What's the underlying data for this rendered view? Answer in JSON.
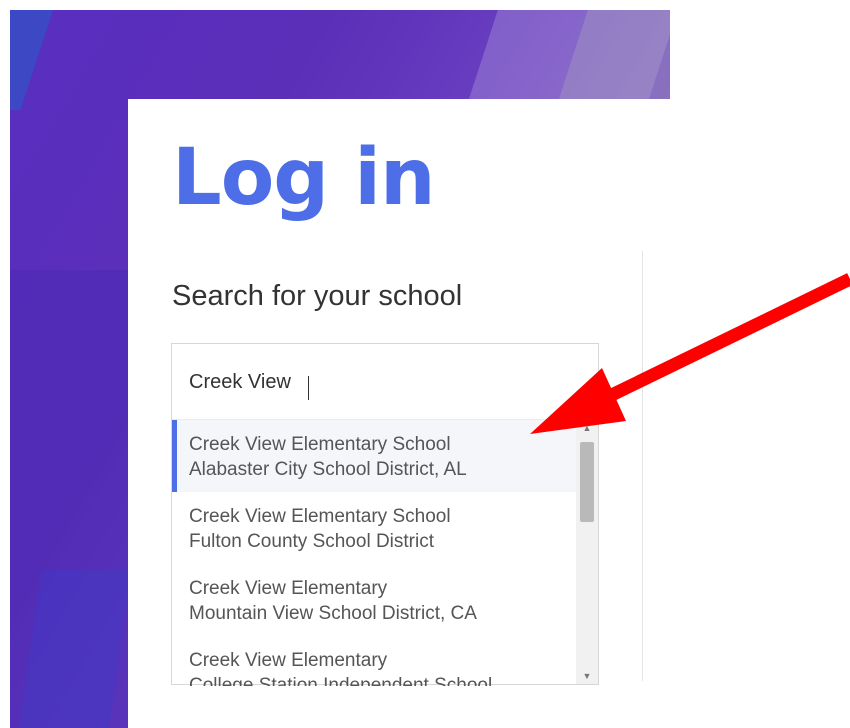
{
  "login": {
    "title": "Log in",
    "search_label": "Search for your school",
    "search_value": "Creek View",
    "results": [
      {
        "name": "Creek View Elementary School",
        "district": "Alabaster City School District, AL"
      },
      {
        "name": "Creek View Elementary School",
        "district": "Fulton County School District"
      },
      {
        "name": "Creek View Elementary",
        "district": "Mountain View School District, CA"
      },
      {
        "name": "Creek View Elementary",
        "district": "College Station Independent School"
      }
    ]
  },
  "icons": {
    "scroll_up": "scroll-up-arrow-icon",
    "scroll_down": "scroll-down-arrow-icon",
    "annotation": "red-arrow-annotation-icon"
  },
  "colors": {
    "accent": "#4d6ee6",
    "annotation": "#ff0000",
    "hero_purple": "#5a2ec0"
  }
}
